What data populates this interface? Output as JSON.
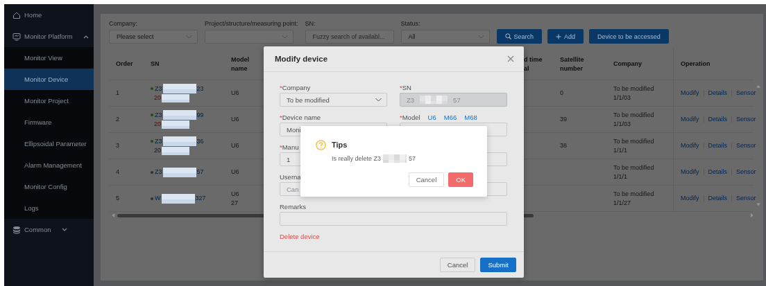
{
  "sidebar": {
    "items": [
      {
        "kind": "link",
        "label": "Home",
        "selected": false
      },
      {
        "kind": "group",
        "label": "Monitor Platform",
        "selected": false,
        "expanded": true,
        "children": [
          {
            "label": "Monitor View",
            "selected": false
          },
          {
            "label": "Monitor Device",
            "selected": true
          },
          {
            "label": "Monitor Project",
            "selected": false
          },
          {
            "label": "Firmware",
            "selected": false
          },
          {
            "label": "Ellipsoidal Parameter",
            "selected": false
          },
          {
            "label": "Alarm Management",
            "selected": false
          },
          {
            "label": "Monitor Config",
            "selected": false
          },
          {
            "label": "Logs",
            "selected": false
          }
        ]
      },
      {
        "kind": "group",
        "label": "Common",
        "selected": false,
        "expanded": false
      }
    ]
  },
  "filters": [
    {
      "kind": "select",
      "label": "Company:",
      "value": "Please select"
    },
    {
      "kind": "select",
      "label": "Project/structure/measuring point:"
    },
    {
      "kind": "input",
      "label": "SN:",
      "placeholder": "Fuzzy search of availabl..."
    },
    {
      "kind": "select",
      "label": "Status:",
      "value": "All"
    }
  ],
  "toolbar_buttons": [
    {
      "kind": "search",
      "label": "Search"
    },
    {
      "kind": "add",
      "label": "Add"
    },
    {
      "kind": "plain",
      "label": "Device to be accessed"
    }
  ],
  "table": {
    "columns": [
      {
        "label": "Order"
      },
      {
        "label": "SN"
      },
      {
        "label": "Model name"
      },
      {
        "label": "d time\nal"
      },
      {
        "label": "Satellite number"
      },
      {
        "label": "Company"
      },
      {
        "label": "Operation"
      }
    ],
    "rows": [
      {
        "order": "1",
        "color": "#1c4f0c",
        "sn_start": "Z3",
        "sn_end": "23",
        "date": "20",
        "date_alert": true,
        "model": "U6",
        "satellite": "0",
        "company": "To be modified\n1/1/03",
        "operations": [
          "Modify",
          "Details",
          "Sensor"
        ]
      },
      {
        "order": "2",
        "color": "#1c4f0c",
        "sn_start": "Z3",
        "sn_end": "99",
        "date": "20",
        "date_alert": true,
        "model": "U6",
        "satellite": "39",
        "company": "To be modified\n1/1/03",
        "operations": [
          "Modify",
          "Details",
          "Sensor"
        ]
      },
      {
        "order": "3",
        "color": "#1c4f0c",
        "sn_start": "Z3",
        "sn_end": "36",
        "date": "20",
        "date_alert": false,
        "model": "U6",
        "satellite": "38",
        "company": "To be modified\n1/1/1",
        "operations": [
          "Modify",
          "Details",
          "Sensor"
        ]
      },
      {
        "order": "4",
        "color": "#2f3033",
        "sn_start": "Z3",
        "sn_end": "57",
        "model": "U6",
        "company": "To be modified\n1/1/1",
        "operations": [
          "Modify",
          "Details",
          "Sensor"
        ]
      },
      {
        "order": "5",
        "color": "#2f3033",
        "sn_start": "W",
        "sn_end": "327",
        "model": "U6",
        "name": "27",
        "company": "To be modified\n1/1/27",
        "operations": [
          "Modify",
          "Details",
          "Sensor"
        ]
      }
    ]
  },
  "modal": {
    "title": "Modify device",
    "fields": [
      {
        "kind": "select",
        "required_mark": "*",
        "label": "Company",
        "value": "To be modified",
        "disabled": false,
        "wide": false
      },
      {
        "kind": "masked",
        "required_mark": "*",
        "label": "SN",
        "value_start": "Z3",
        "value_end": "57",
        "disabled": true,
        "wide": false
      },
      {
        "kind": "input",
        "required_mark": "*",
        "label": "Device name",
        "value": "Moni",
        "disabled": false,
        "wide": false
      },
      {
        "kind": "input",
        "required_mark": "*",
        "label": "Model",
        "links": [
          "U6",
          "M66",
          "M68"
        ],
        "disabled": false,
        "wide": false
      },
      {
        "kind": "input",
        "required_mark": "*",
        "label": "Manu",
        "value": "1",
        "disabled": false,
        "wide": false
      },
      {
        "kind": "input",
        "disabled": false,
        "wide": false
      },
      {
        "kind": "input",
        "label": "Userna",
        "placeholder": "Can",
        "disabled": false,
        "wide": false
      },
      {
        "kind": "input",
        "disabled": false,
        "wide": false
      },
      {
        "kind": "input",
        "label": "Remarks",
        "disabled": false,
        "wide": true
      }
    ],
    "delete_link": "Delete device",
    "buttons": [
      {
        "kind": "default",
        "label": "Cancel"
      },
      {
        "kind": "primary",
        "label": "Submit"
      }
    ]
  },
  "tips": {
    "title": "Tips",
    "message_start": "Is really delete Z3",
    "message_end": "57",
    "buttons": [
      {
        "kind": "default",
        "label": "Cancel"
      },
      {
        "kind": "danger",
        "label": "OK"
      }
    ]
  }
}
